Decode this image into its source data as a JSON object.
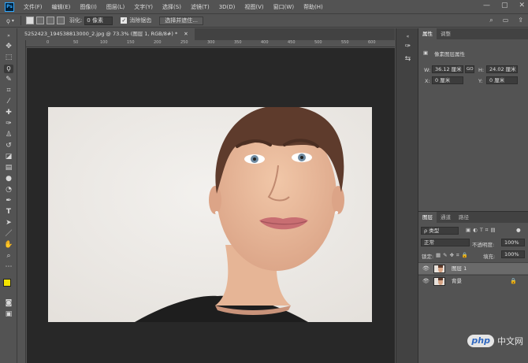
{
  "menubar": {
    "logo": "Ps",
    "items": [
      "文件(F)",
      "编辑(E)",
      "图像(I)",
      "图层(L)",
      "文字(Y)",
      "选择(S)",
      "滤镜(T)",
      "3D(D)",
      "视图(V)",
      "窗口(W)",
      "帮助(H)"
    ]
  },
  "options": {
    "feather_label": "羽化:",
    "feather_value": "0 像素",
    "antialias_label": "消除锯齿",
    "select_mask_button": "选择并遮住..."
  },
  "document": {
    "tab_title": "5252423_194538813000_2.jpg @ 73.3% (图层 1, RGB/8#) *",
    "ruler_top_marks": [
      "0",
      "50",
      "100",
      "150",
      "200",
      "250",
      "300",
      "350",
      "400",
      "450",
      "500",
      "550",
      "600"
    ]
  },
  "properties": {
    "tabs": [
      "属性",
      "调整"
    ],
    "title": "像素图层属性",
    "w_label": "W:",
    "w_value": "36.12 厘米",
    "link": "GO",
    "h_label": "H:",
    "h_value": "24.02 厘米",
    "x_label": "X:",
    "x_value": "0 厘米",
    "y_label": "Y:",
    "y_value": "0 厘米"
  },
  "layers": {
    "tabs": [
      "图层",
      "通道",
      "路径"
    ],
    "filter_kind": "ρ 类型",
    "blend_mode": "正常",
    "opacity_label": "不透明度:",
    "opacity_value": "100%",
    "lock_label": "锁定:",
    "fill_label": "填充:",
    "fill_value": "100%",
    "items": [
      {
        "name": "图层 1",
        "selected": true
      },
      {
        "name": "背景",
        "selected": false
      }
    ]
  },
  "watermark": {
    "logo": "php",
    "text": "中文网"
  }
}
